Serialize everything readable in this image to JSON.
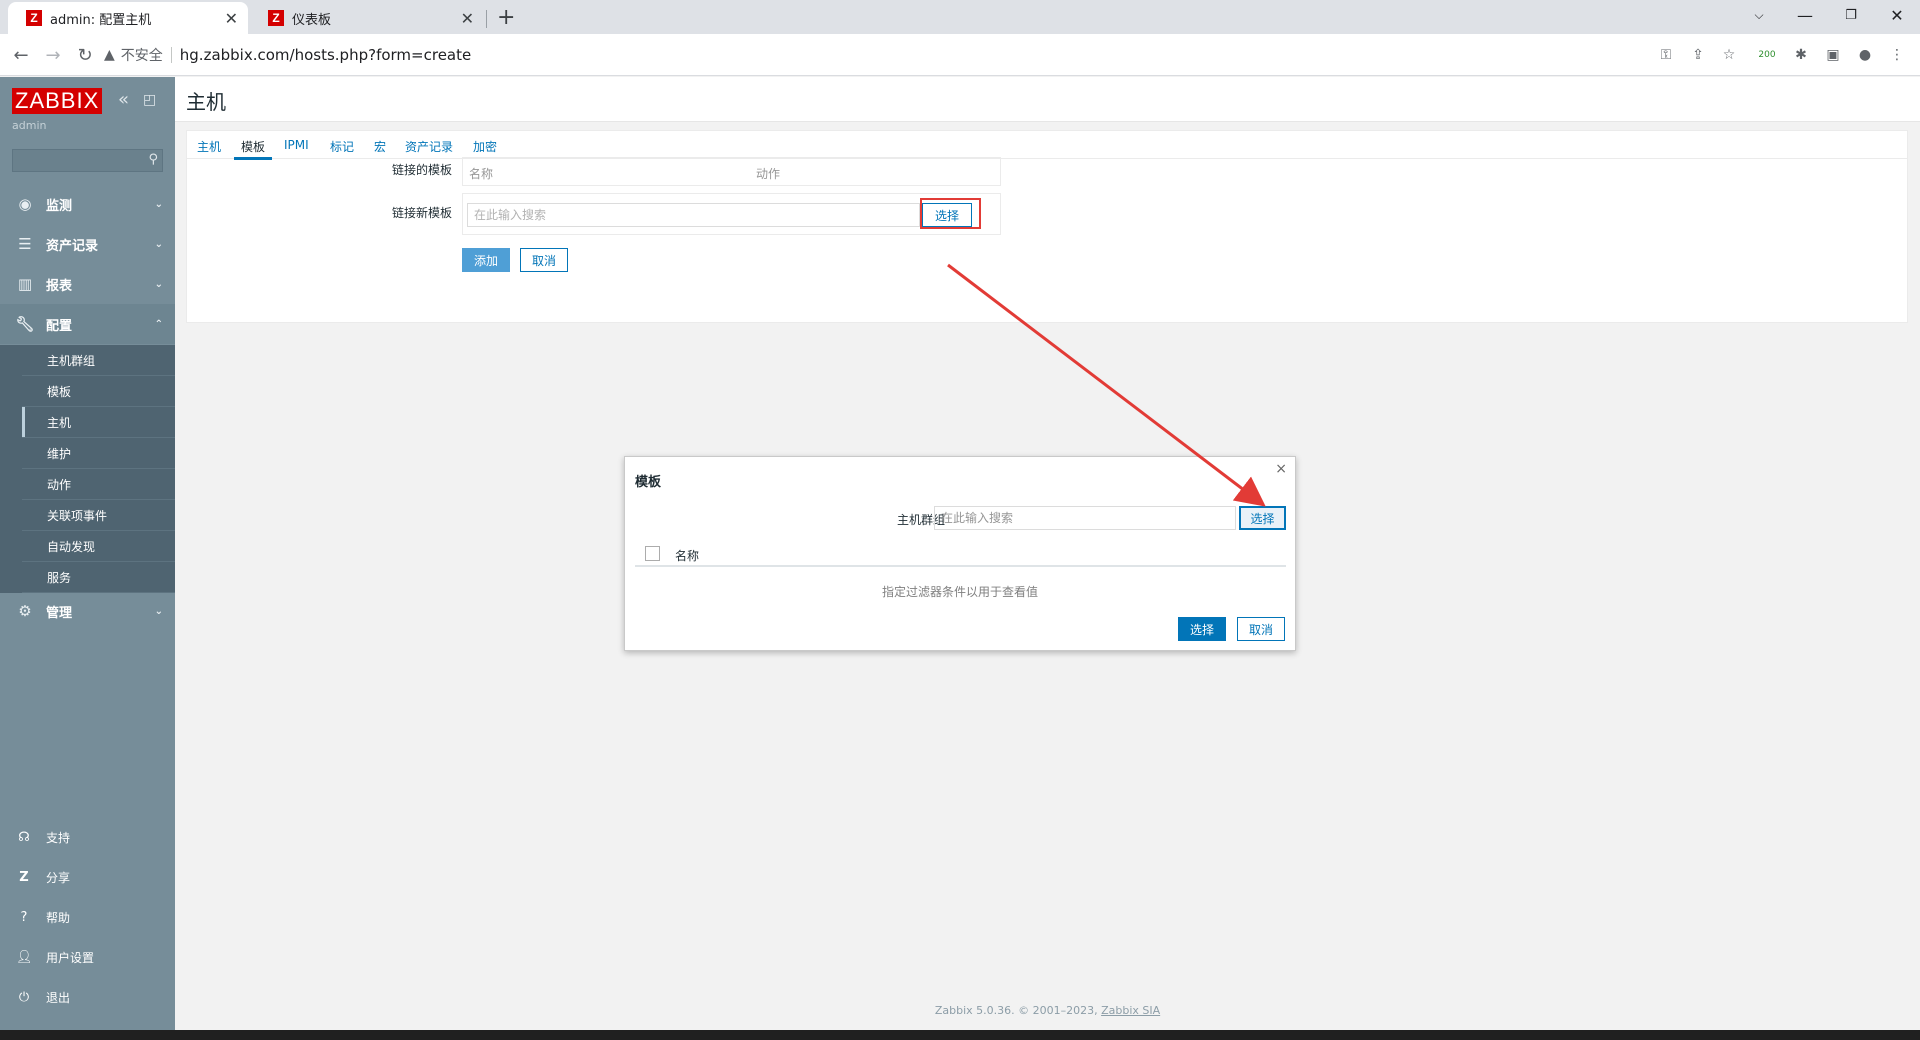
{
  "browser": {
    "tabs": [
      {
        "title": "admin: 配置主机",
        "favicon": "Z"
      },
      {
        "title": "仪表板",
        "favicon": "Z"
      }
    ],
    "new_tab": "+",
    "security": "不安全",
    "url": "hg.zabbix.com/hosts.php?form=create",
    "extension_badge": "200"
  },
  "sidebar": {
    "logo": "ZABBIX",
    "user": "admin",
    "menu": [
      {
        "label": "监测",
        "icon": "eye-icon"
      },
      {
        "label": "资产记录",
        "icon": "list-icon"
      },
      {
        "label": "报表",
        "icon": "bar-chart-icon"
      },
      {
        "label": "配置",
        "icon": "wrench-icon"
      },
      {
        "label": "管理",
        "icon": "gear-icon"
      }
    ],
    "submenu": [
      "主机群组",
      "模板",
      "主机",
      "维护",
      "动作",
      "关联项事件",
      "自动发现",
      "服务"
    ],
    "footer": [
      {
        "label": "支持",
        "icon": "headset-icon"
      },
      {
        "label": "分享",
        "icon": "z-share-icon"
      },
      {
        "label": "帮助",
        "icon": "question-icon"
      },
      {
        "label": "用户设置",
        "icon": "user-icon"
      },
      {
        "label": "退出",
        "icon": "power-icon"
      }
    ]
  },
  "page": {
    "title": "主机",
    "tabs": [
      "主机",
      "模板",
      "IPMI",
      "标记",
      "宏",
      "资产记录",
      "加密"
    ],
    "active_tab": "模板",
    "linked_label": "链接的模板",
    "linked_cols": [
      "名称",
      "动作"
    ],
    "new_label": "链接新模板",
    "search_placeholder": "在此输入搜索",
    "select_button": "选择",
    "add_button": "添加",
    "cancel_button": "取消"
  },
  "dialog": {
    "title": "模板",
    "close": "×",
    "group_label": "主机群组",
    "group_placeholder": "在此输入搜索",
    "group_select": "选择",
    "col_name": "名称",
    "empty_text": "指定过滤器条件以用于查看值",
    "select_button": "选择",
    "cancel_button": "取消"
  },
  "footer": {
    "copyright": "Zabbix 5.0.36. © 2001–2023, ",
    "company": "Zabbix SIA"
  },
  "colors": {
    "accent": "#0275b8",
    "sidebar": "#768d99",
    "logo": "#d40000",
    "annotation": "#e23b36"
  }
}
